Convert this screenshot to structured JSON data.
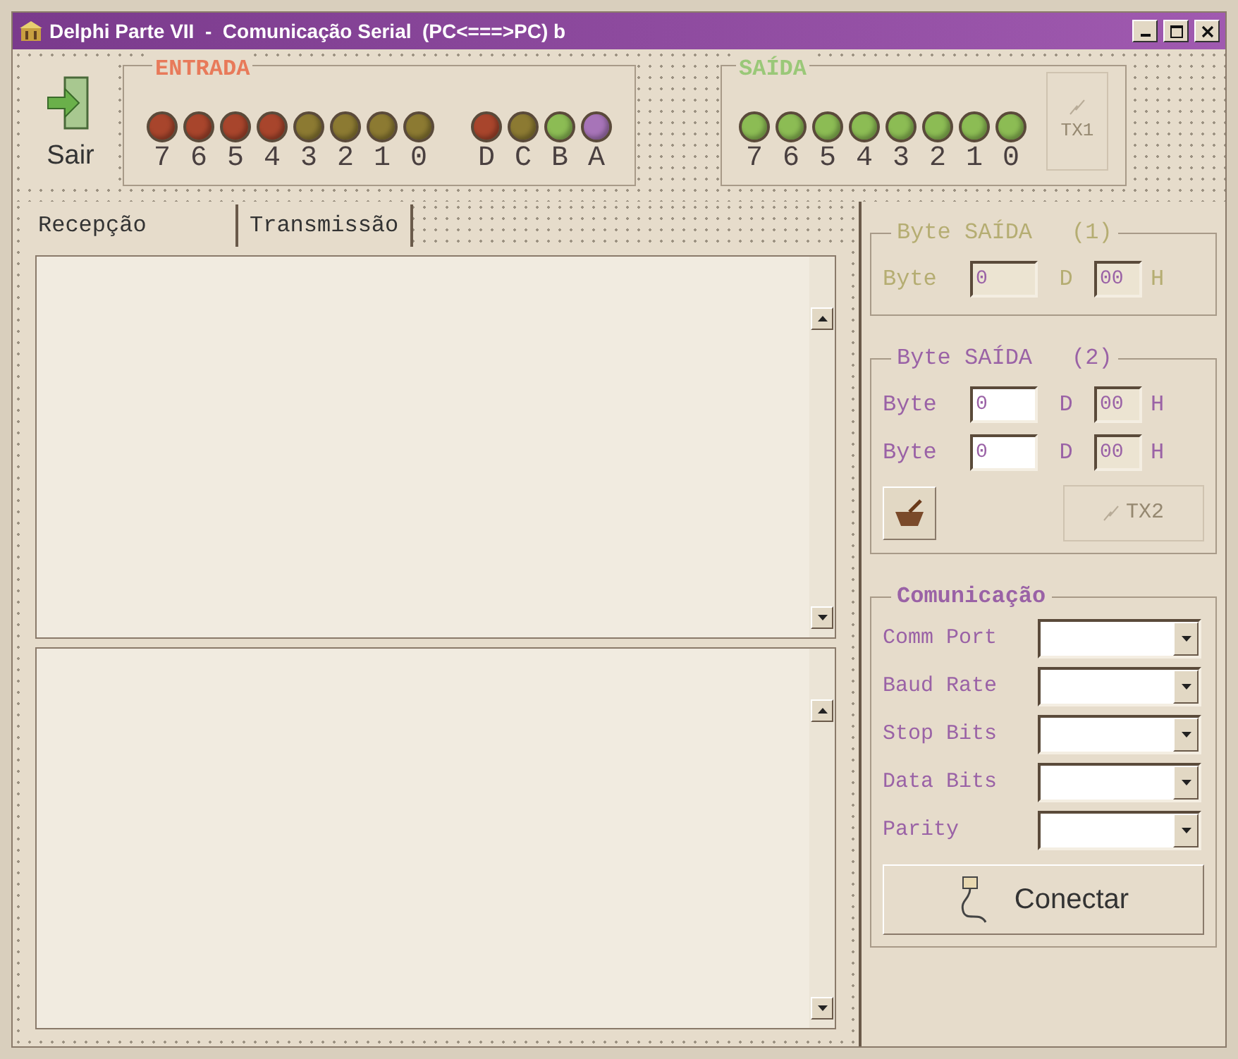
{
  "window": {
    "title": "Delphi Parte VII  -  Comunicação Serial  (PC<===>PC) b"
  },
  "exit_button": {
    "label": "Sair"
  },
  "entrada": {
    "title": "ENTRADA",
    "bits": [
      {
        "label": "7",
        "color": "#a8452c"
      },
      {
        "label": "6",
        "color": "#a8452c"
      },
      {
        "label": "5",
        "color": "#a8452c"
      },
      {
        "label": "4",
        "color": "#a8452c"
      },
      {
        "label": "3",
        "color": "#8c7a32"
      },
      {
        "label": "2",
        "color": "#8c7a32"
      },
      {
        "label": "1",
        "color": "#8c7a32"
      },
      {
        "label": "0",
        "color": "#8c7a32"
      }
    ],
    "lines": [
      {
        "label": "D",
        "color": "#a8452c"
      },
      {
        "label": "C",
        "color": "#8c7a32"
      },
      {
        "label": "B",
        "color": "#8cbc54"
      },
      {
        "label": "A",
        "color": "#a774b8"
      }
    ]
  },
  "saida": {
    "title": "SAÍDA",
    "bits": [
      {
        "label": "7",
        "color": "#8cbc54"
      },
      {
        "label": "6",
        "color": "#8cbc54"
      },
      {
        "label": "5",
        "color": "#8cbc54"
      },
      {
        "label": "4",
        "color": "#8cbc54"
      },
      {
        "label": "3",
        "color": "#8cbc54"
      },
      {
        "label": "2",
        "color": "#8cbc54"
      },
      {
        "label": "1",
        "color": "#8cbc54"
      },
      {
        "label": "0",
        "color": "#8cbc54"
      }
    ]
  },
  "tx1_button": {
    "label": "TX1",
    "disabled": true
  },
  "tabs": [
    {
      "label": "Recepção",
      "selected": true
    },
    {
      "label": "Transmissão",
      "selected": false
    }
  ],
  "byte_out_1": {
    "title": "Byte SAÍDA",
    "number": "(1)",
    "disabled": true,
    "rows": [
      {
        "label": "Byte",
        "decimal": "0",
        "d": "D",
        "hex": "00",
        "h": "H"
      }
    ]
  },
  "byte_out_2": {
    "title": "Byte SAÍDA",
    "number": "(2)",
    "disabled": false,
    "rows": [
      {
        "label": "Byte",
        "decimal": "0",
        "d": "D",
        "hex": "00",
        "h": "H"
      },
      {
        "label": "Byte",
        "decimal": "0",
        "d": "D",
        "hex": "00",
        "h": "H"
      }
    ],
    "tx2_button": {
      "label": "TX2",
      "disabled": true
    }
  },
  "communication": {
    "title": "Comunicação",
    "fields": [
      {
        "label": "Comm Port"
      },
      {
        "label": "Baud Rate"
      },
      {
        "label": "Stop Bits"
      },
      {
        "label": "Data Bits"
      },
      {
        "label": "Parity"
      }
    ],
    "connect_button": {
      "label": "Conectar"
    }
  }
}
